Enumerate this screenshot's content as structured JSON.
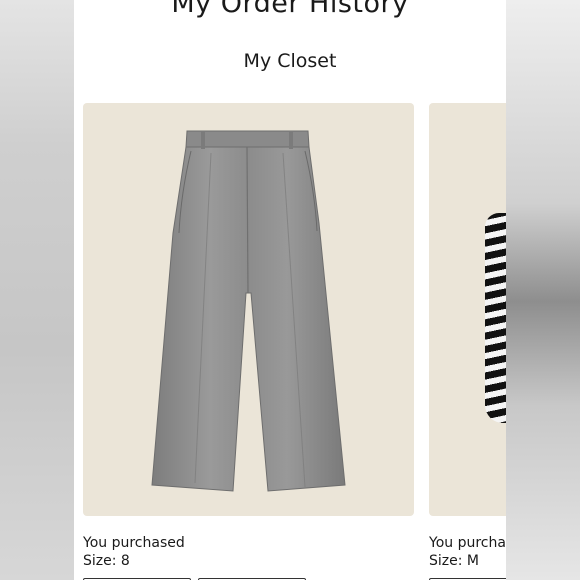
{
  "header": {
    "page_title": "My Order History",
    "section_title": "My Closet"
  },
  "closet_items": [
    {
      "image_icon": "gray-wide-leg-trousers",
      "purchase_label": "You purchased",
      "size_label": "Size: 8"
    },
    {
      "image_icon": "black-white-striped-top",
      "purchase_label": "You purchas",
      "size_label": "Size: M"
    }
  ],
  "colors": {
    "card_background": "#ebe5d8",
    "trousers": "#8f8f8f"
  }
}
